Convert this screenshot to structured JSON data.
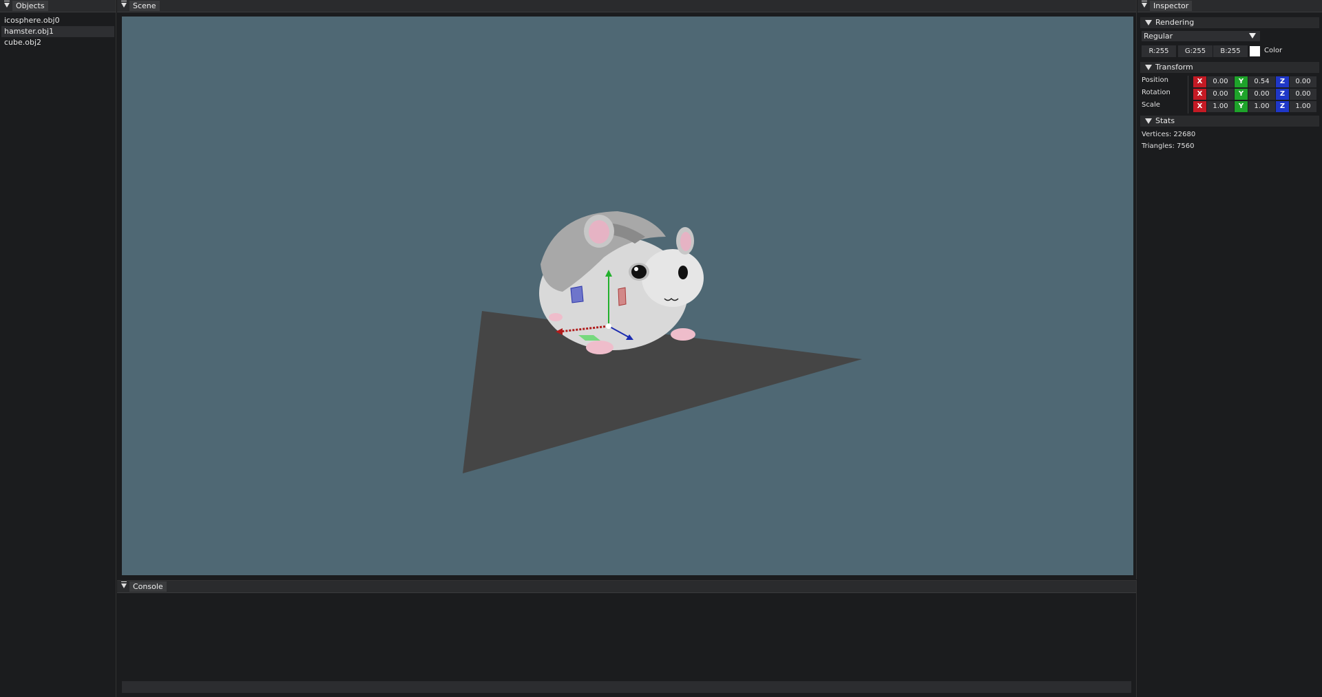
{
  "objects": {
    "title": "Objects",
    "items": [
      {
        "label": "icosphere.obj0"
      },
      {
        "label": "hamster.obj1"
      },
      {
        "label": "cube.obj2"
      }
    ]
  },
  "scene": {
    "title": "Scene"
  },
  "console": {
    "title": "Console"
  },
  "inspector": {
    "title": "Inspector",
    "rendering": {
      "header": "Rendering",
      "mode": "Regular",
      "r": "R:255",
      "g": "G:255",
      "b": "B:255",
      "color_label": "Color",
      "color": "#ffffff"
    },
    "transform": {
      "header": "Transform",
      "rows": [
        {
          "label": "Position",
          "x": "0.00",
          "y": "0.54",
          "z": "0.00"
        },
        {
          "label": "Rotation",
          "x": "0.00",
          "y": "0.00",
          "z": "0.00"
        },
        {
          "label": "Scale",
          "x": "1.00",
          "y": "1.00",
          "z": "1.00"
        }
      ],
      "axis_x": "X",
      "axis_y": "Y",
      "axis_z": "Z"
    },
    "stats": {
      "header": "Stats",
      "vertices": "Vertices: 22680",
      "triangles": "Triangles: 7560"
    }
  }
}
